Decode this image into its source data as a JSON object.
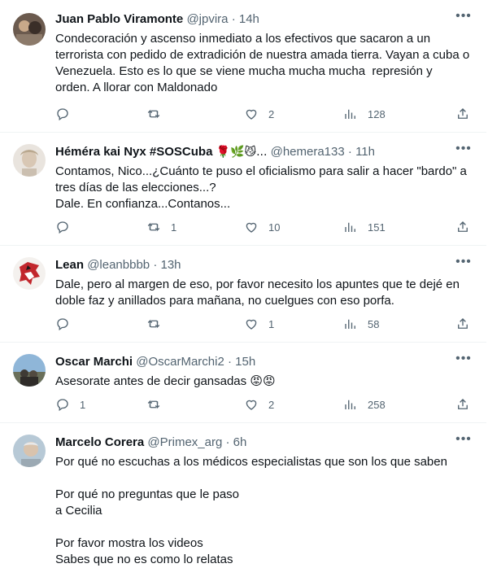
{
  "tweets": [
    {
      "name": "Juan Pablo Viramonte",
      "name_extra": "",
      "handle": "@jpvira",
      "time": "14h",
      "text": "Condecoración y ascenso inmediato a los efectivos que sacaron a un terrorista con pedido de extradición de nuestra amada tierra. Vayan a cuba o Venezuela. Esto es lo que se viene mucha mucha mucha  represión y orden. A llorar con Maldonado",
      "replies": "",
      "retweets": "",
      "likes": "2",
      "views": "128"
    },
    {
      "name": "Héméra kai Nyx #SOSCuba",
      "name_extra": "🌹🌿😼...",
      "handle": "@hemera133",
      "time": "11h",
      "text": "Contamos, Nico...¿Cuánto te puso el oficialismo para salir a hacer \"bardo\" a tres días de las elecciones...?\nDale. En confianza...Contanos...",
      "replies": "",
      "retweets": "1",
      "likes": "10",
      "views": "151"
    },
    {
      "name": "Lean",
      "name_extra": "",
      "handle": "@leanbbbb",
      "time": "13h",
      "text": "Dale, pero al margen de eso, por favor necesito los apuntes que te dejé en doble faz y anillados para mañana, no cuelgues con eso porfa.",
      "replies": "",
      "retweets": "",
      "likes": "1",
      "views": "58"
    },
    {
      "name": "Oscar Marchi",
      "name_extra": "",
      "handle": "@OscarMarchi2",
      "time": "15h",
      "text": "Asesorate antes de decir gansadas 😡😡",
      "replies": "1",
      "retweets": "",
      "likes": "2",
      "views": "258"
    },
    {
      "name": "Marcelo Corera",
      "name_extra": "",
      "handle": "@Primex_arg",
      "time": "6h",
      "text": "Por qué no escuchas a los médicos especialistas que son los que saben\n\nPor qué no preguntas que le paso\na Cecilia\n\nPor favor mostra los videos\nSabes que no es como lo relatas",
      "replies": "",
      "retweets": "",
      "likes": "",
      "views": ""
    }
  ],
  "dot": "·",
  "more_label": "•••",
  "icons": {
    "reply": "reply-icon",
    "retweet": "retweet-icon",
    "like": "heart-icon",
    "views": "views-icon",
    "share": "share-icon",
    "more": "more-icon"
  },
  "colors": {
    "text": "#0f1419",
    "secondary": "#536471",
    "divider": "#eff3f4"
  }
}
